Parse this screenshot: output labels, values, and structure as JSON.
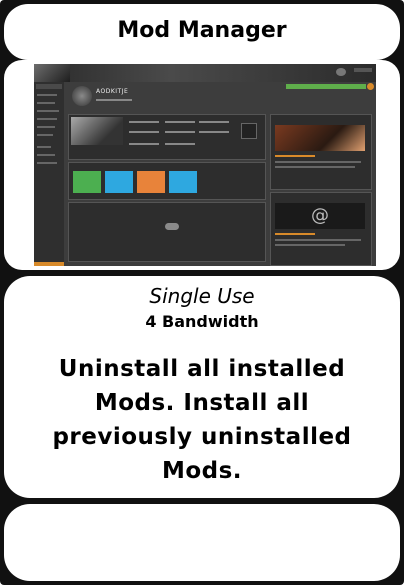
{
  "card": {
    "title": "Mod Manager",
    "usage": "Single Use",
    "cost": "4 Bandwidth",
    "description": "Uninstall all installed Mods. Install all previously uninstalled Mods."
  },
  "app_screenshot": {
    "game_title": "AODKITJE",
    "colors": {
      "background": "#3d3d3d",
      "panel": "#2d2d2d",
      "accent_orange": "#d88a2a",
      "tile_green": "#4caf50",
      "tile_blue": "#2ea8e0",
      "tile_orange": "#e8833a",
      "sync_bar": "#5fae4b"
    }
  }
}
